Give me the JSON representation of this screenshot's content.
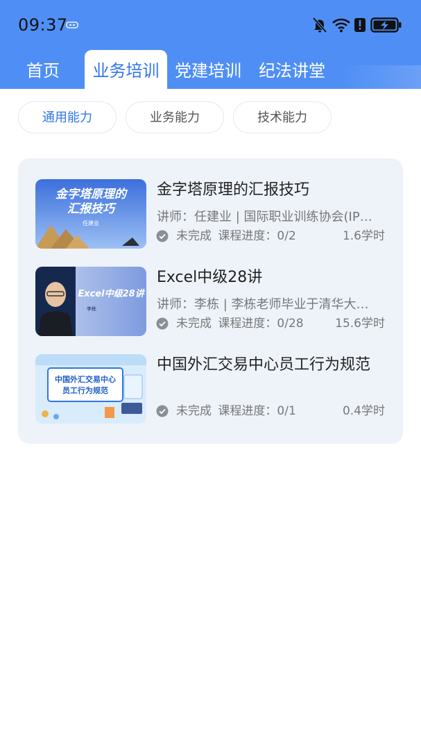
{
  "status_bar": {
    "time": "09:37",
    "icons": [
      "usb-icon",
      "bell-off-icon",
      "wifi-icon",
      "alert-icon",
      "battery-charging-icon"
    ]
  },
  "tabs": [
    {
      "label": "首页",
      "active": false
    },
    {
      "label": "业务培训",
      "active": true
    },
    {
      "label": "党建培训",
      "active": false
    },
    {
      "label": "纪法讲堂",
      "active": false
    }
  ],
  "filters": [
    {
      "label": "通用能力",
      "active": true
    },
    {
      "label": "业务能力",
      "active": false
    },
    {
      "label": "技术能力",
      "active": false
    }
  ],
  "courses": [
    {
      "title": "金字塔原理的汇报技巧",
      "teacher": "讲师：任建业 | 国际职业训练协会(IP…",
      "status": "未完成",
      "progress_label": "课程进度：0/2",
      "hours": "1.6学时",
      "thumb_text": "金字塔原理的汇报技巧",
      "thumb_line1": "金字塔原理的",
      "thumb_line2": "汇报技巧",
      "thumb_presenter": "任建业"
    },
    {
      "title": "Excel中级28讲",
      "teacher": "讲师：李栋 | 李栋老师毕业于清华大…",
      "status": "未完成",
      "progress_label": "课程进度：0/28",
      "hours": "15.6学时",
      "thumb_text": "Excel中级28讲",
      "thumb_presenter": "李栋"
    },
    {
      "title": "中国外汇交易中心员工行为规范",
      "teacher": "",
      "status": "未完成",
      "progress_label": "课程进度：0/1",
      "hours": "0.4学时",
      "thumb_line1": "中国外汇交易中心",
      "thumb_line2": "员工行为规范"
    }
  ],
  "colors": {
    "header_blue": "#4f8ff5",
    "accent_blue": "#2f76e8",
    "panel_bg": "#eef3fa"
  }
}
